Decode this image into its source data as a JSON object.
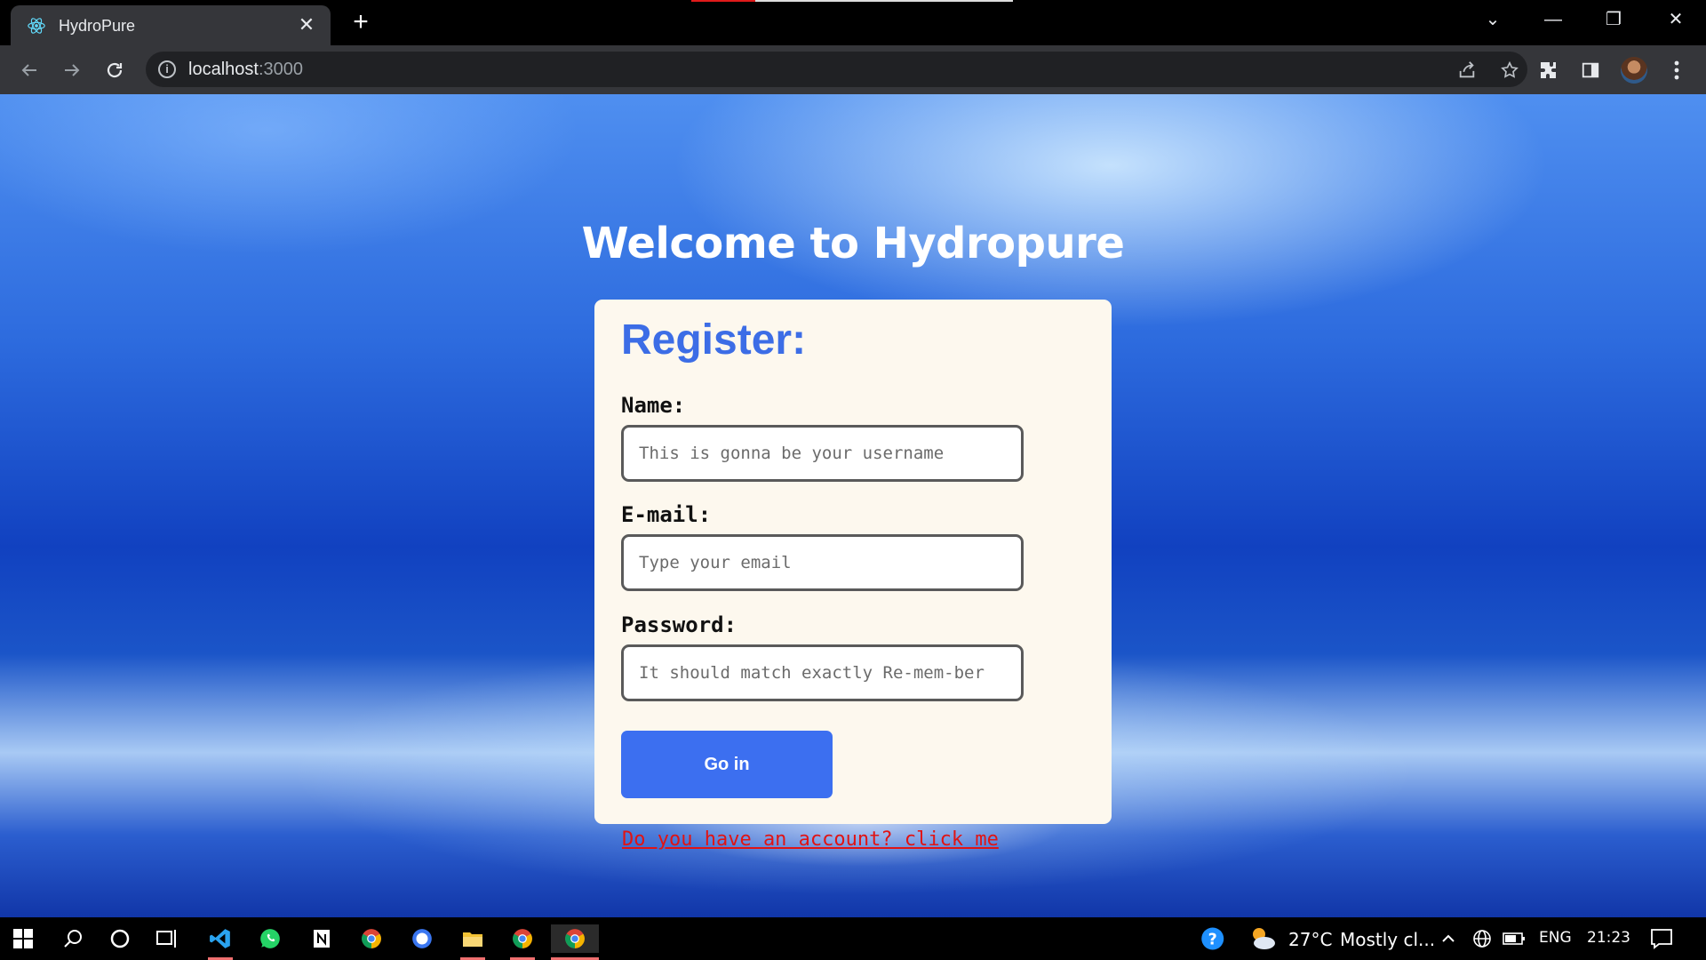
{
  "browser": {
    "tab_title": "HydroPure",
    "tab_close": "✕",
    "new_tab": "+",
    "url_host": "localhost",
    "url_port": ":3000",
    "info_glyph": "i",
    "icons": {
      "favicon": "react-atom-icon",
      "back": "arrow-left-icon",
      "forward": "arrow-right-icon",
      "reload": "reload-icon",
      "share": "share-icon",
      "bookmark": "star-icon",
      "extensions": "puzzle-icon",
      "sidepanel": "side-panel-icon",
      "menu": "kebab-menu-icon"
    },
    "window_controls": {
      "tab_search": "⌄",
      "minimize": "—",
      "restore": "❐",
      "close": "✕"
    }
  },
  "page": {
    "heading": "Welcome to Hydropure",
    "form": {
      "title": "Register:",
      "name_label": "Name:",
      "name_placeholder": "This is gonna be your username",
      "email_label": "E-mail:",
      "email_placeholder": "Type your email",
      "password_label": "Password:",
      "password_placeholder": "It should match exactly Re-mem-ber",
      "submit_label": "Go in"
    },
    "login_link": "Do you have an account? click me"
  },
  "taskbar": {
    "weather_temp": "27°C",
    "weather_desc": "Mostly cl...",
    "language": "ENG",
    "time": "21:23",
    "icons": [
      "windows-start-icon",
      "search-icon",
      "cortana-icon",
      "task-view-icon",
      "vscode-icon",
      "whatsapp-icon",
      "notion-icon",
      "chrome-icon",
      "signal-icon",
      "file-explorer-icon",
      "chrome-icon",
      "chrome-icon"
    ]
  },
  "colors": {
    "accent": "#3c6de6",
    "button": "#3c6ff0",
    "card_bg": "#fdf8ee",
    "link": "#e01414"
  }
}
